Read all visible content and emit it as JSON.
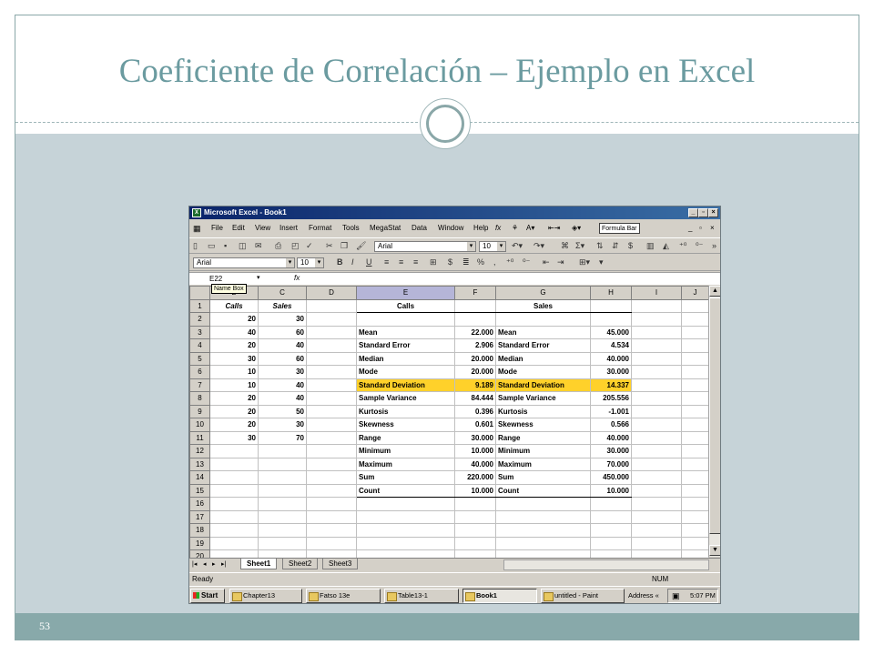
{
  "slide": {
    "title": "Coeficiente de Correlación  – Ejemplo en Excel",
    "page_number": "53"
  },
  "excel": {
    "window_title": "Microsoft Excel - Book1",
    "menu": [
      "File",
      "Edit",
      "View",
      "Insert",
      "Format",
      "Tools",
      "MegaStat",
      "Data",
      "Window",
      "Help"
    ],
    "formula_bar_button": "Formula Bar",
    "font_name": "Arial",
    "font_size": "10",
    "font_name_2": "Arial",
    "font_size_2": "10",
    "name_box": "E22",
    "name_box_tooltip": "Name Box",
    "fx": "fx",
    "columns": [
      "",
      "B",
      "C",
      "D",
      "E",
      "F",
      "G",
      "H",
      "I",
      "J"
    ],
    "rows": [
      [
        "1",
        "Calls",
        "Sales",
        "",
        "Calls",
        "",
        "Sales",
        "",
        "",
        ""
      ],
      [
        "2",
        "20",
        "30",
        "",
        "",
        "",
        "",
        "",
        "",
        ""
      ],
      [
        "3",
        "40",
        "60",
        "",
        "Mean",
        "22.000",
        "Mean",
        "45.000",
        "",
        ""
      ],
      [
        "4",
        "20",
        "40",
        "",
        "Standard Error",
        "2.906",
        "Standard Error",
        "4.534",
        "",
        ""
      ],
      [
        "5",
        "30",
        "60",
        "",
        "Median",
        "20.000",
        "Median",
        "40.000",
        "",
        ""
      ],
      [
        "6",
        "10",
        "30",
        "",
        "Mode",
        "20.000",
        "Mode",
        "30.000",
        "",
        ""
      ],
      [
        "7",
        "10",
        "40",
        "",
        "Standard Deviation",
        "9.189",
        "Standard Deviation",
        "14.337",
        "",
        ""
      ],
      [
        "8",
        "20",
        "40",
        "",
        "Sample Variance",
        "84.444",
        "Sample Variance",
        "205.556",
        "",
        ""
      ],
      [
        "9",
        "20",
        "50",
        "",
        "Kurtosis",
        "0.396",
        "Kurtosis",
        "-1.001",
        "",
        ""
      ],
      [
        "10",
        "20",
        "30",
        "",
        "Skewness",
        "0.601",
        "Skewness",
        "0.566",
        "",
        ""
      ],
      [
        "11",
        "30",
        "70",
        "",
        "Range",
        "30.000",
        "Range",
        "40.000",
        "",
        ""
      ],
      [
        "12",
        "",
        "",
        "",
        "Minimum",
        "10.000",
        "Minimum",
        "30.000",
        "",
        ""
      ],
      [
        "13",
        "",
        "",
        "",
        "Maximum",
        "40.000",
        "Maximum",
        "70.000",
        "",
        ""
      ],
      [
        "14",
        "",
        "",
        "",
        "Sum",
        "220.000",
        "Sum",
        "450.000",
        "",
        ""
      ],
      [
        "15",
        "",
        "",
        "",
        "Count",
        "10.000",
        "Count",
        "10.000",
        "",
        ""
      ],
      [
        "16",
        "",
        "",
        "",
        "",
        "",
        "",
        "",
        "",
        ""
      ],
      [
        "17",
        "",
        "",
        "",
        "",
        "",
        "",
        "",
        "",
        ""
      ],
      [
        "18",
        "",
        "",
        "",
        "",
        "",
        "",
        "",
        "",
        ""
      ],
      [
        "19",
        "",
        "",
        "",
        "",
        "",
        "",
        "",
        "",
        ""
      ],
      [
        "20",
        "",
        "",
        "",
        "",
        "",
        "",
        "",
        "",
        ""
      ]
    ],
    "highlight_color": "#ffd12a",
    "sheets": [
      "Sheet1",
      "Sheet2",
      "Sheet3"
    ],
    "status_left": "Ready",
    "status_right": "NUM"
  },
  "taskbar": {
    "start": "Start",
    "tasks": [
      "Chapter13",
      "Fatso 13e",
      "Table13-1",
      "Book1",
      "untitled - Paint"
    ],
    "active_task": "Book1",
    "address": "Address",
    "address_chevron": "«",
    "clock": "5:07 PM"
  }
}
